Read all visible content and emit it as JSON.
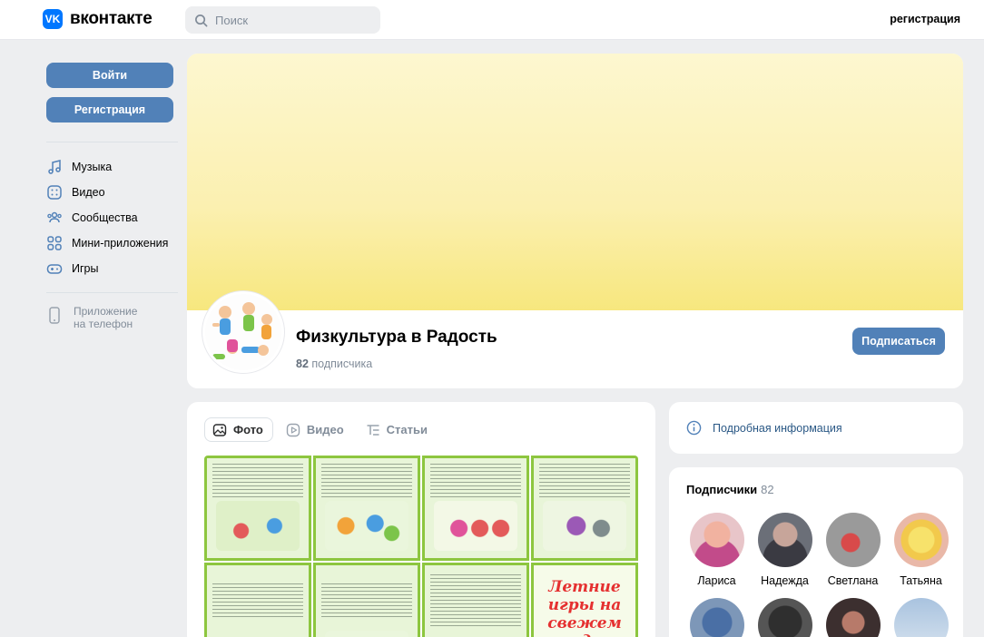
{
  "header": {
    "logo_text": "вконтакте",
    "logo_mark": "VK",
    "search_placeholder": "Поиск",
    "register_link": "регистрация"
  },
  "sidebar": {
    "login_button": "Войти",
    "register_button": "Регистрация",
    "items": [
      {
        "label": "Музыка",
        "icon": "music-icon"
      },
      {
        "label": "Видео",
        "icon": "video-icon"
      },
      {
        "label": "Сообщества",
        "icon": "communities-icon"
      },
      {
        "label": "Мини-приложения",
        "icon": "mini-apps-icon"
      },
      {
        "label": "Игры",
        "icon": "games-icon"
      }
    ],
    "app_line1": "Приложение",
    "app_line2": "на телефон"
  },
  "group": {
    "name": "Физкультура в Радость",
    "subscriber_count": "82",
    "subscriber_label": "подписчика",
    "subscribe_button": "Подписаться"
  },
  "media": {
    "tabs": [
      {
        "label": "Фото",
        "active": true
      },
      {
        "label": "Видео",
        "active": false
      },
      {
        "label": "Статьи",
        "active": false
      }
    ],
    "featured_photo_title": "Летние игры на свежем воздухе"
  },
  "info": {
    "label": "Подробная информация"
  },
  "subscribers": {
    "title": "Подписчики",
    "count": "82",
    "people": [
      {
        "name": "Лариса"
      },
      {
        "name": "Надежда"
      },
      {
        "name": "Светлана"
      },
      {
        "name": "Татьяна"
      }
    ]
  },
  "colors": {
    "accent": "#5181b8",
    "brand": "#0077ff",
    "link": "#2a5885",
    "background": "#edeef0"
  }
}
